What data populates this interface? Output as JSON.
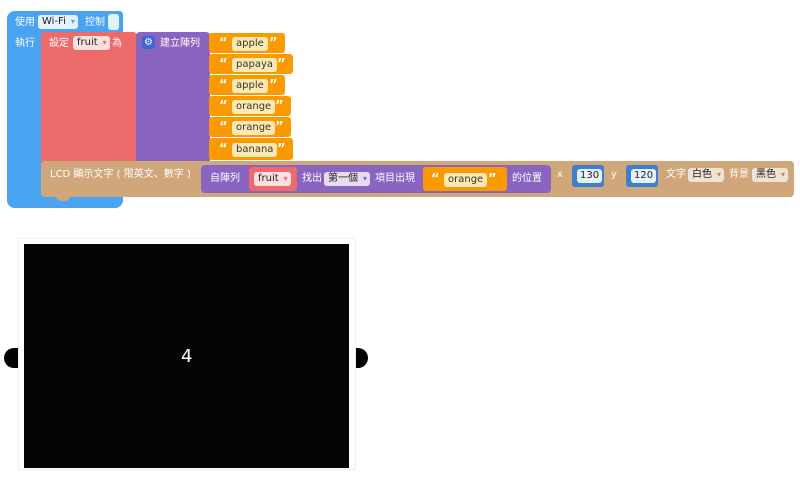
{
  "event_block": {
    "prefix": "使用",
    "wifi_dropdown": "Wi-Fi",
    "suffix": "控制",
    "do_label": "執行"
  },
  "set_block": {
    "label": "設定",
    "variable": "fruit",
    "to_label": "為"
  },
  "array_block": {
    "label": "建立陣列",
    "items": [
      "apple",
      "papaya",
      "apple",
      "orange",
      "orange",
      "banana"
    ]
  },
  "lcd_block": {
    "label": "LCD 顯示文字 ( 限英文、數字 )",
    "from_array_label": "自陣列",
    "array_var": "fruit",
    "find_label": "找出",
    "occurrence": "第一個",
    "item_label": "項目出現",
    "search_value": "orange",
    "position_label": "的位置",
    "x_label": "x",
    "x_value": "130",
    "y_label": "y",
    "y_value": "120",
    "text_color_label": "文字",
    "text_color": "白色",
    "bg_label": "背景",
    "bg_color": "黑色"
  },
  "lcd_screen": {
    "display_text": "4"
  },
  "colors": {
    "event_blue": "#4aa3f0",
    "variable_red": "#ec6a6a",
    "array_purple": "#8a64c1",
    "string_orange": "#fb9a00",
    "lcd_brown": "#d0a67b",
    "screen_black": "#050505"
  }
}
